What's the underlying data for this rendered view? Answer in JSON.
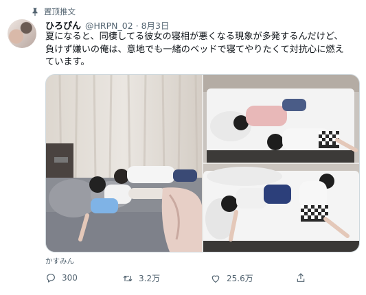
{
  "pinned_label": "置顶推文",
  "tweet": {
    "display_name": "ひろぴん",
    "handle_date": "@HRPN_02 · 8月3日",
    "text_lines": [
      "夏になると、同棲してる彼女の寝相が悪くなる現象が多発するんだけど、",
      "負けず嫌いの俺は、意地でも一緒のベッドで寝てやりたくて対抗心に燃え",
      "ています。"
    ],
    "media_caption": "かすみん"
  },
  "actions": {
    "reply_count": "300",
    "retweet_count": "3.2万",
    "like_count": "25.6万"
  },
  "icons": {
    "pin": "pin-icon",
    "reply": "reply-icon",
    "retweet": "retweet-icon",
    "like": "heart-icon",
    "share": "share-icon"
  },
  "colors": {
    "secondary_text": "#536471",
    "border": "#cfd9de"
  }
}
